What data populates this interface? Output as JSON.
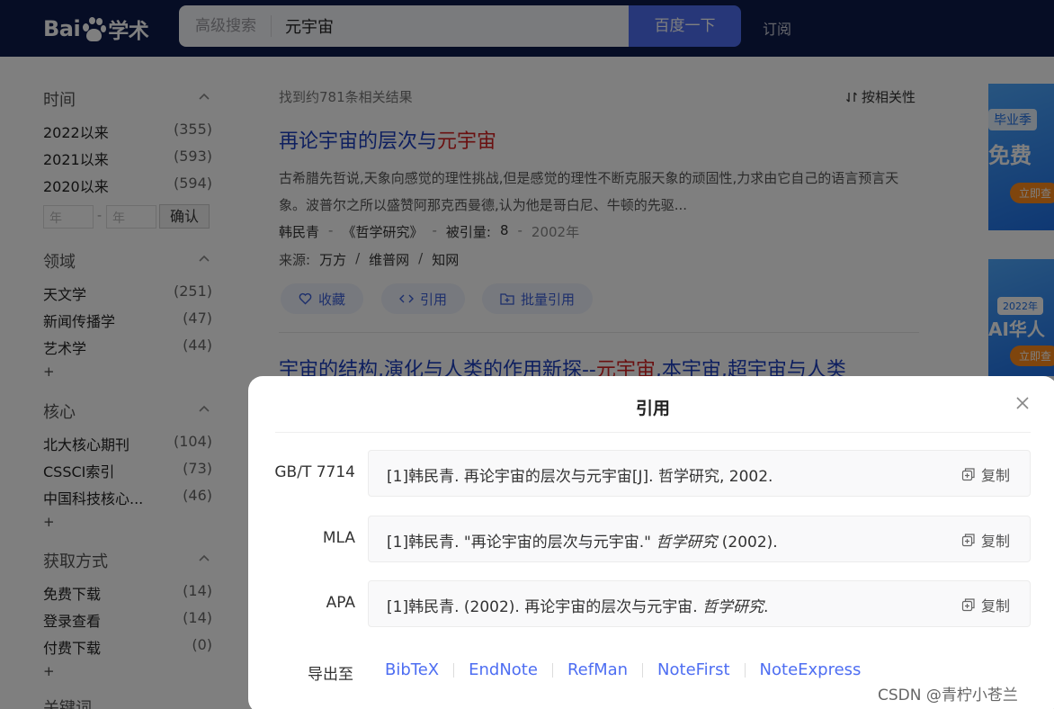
{
  "header": {
    "logo_text_left": "Bai",
    "logo_text_right": "学术",
    "advanced_search": "高级搜索",
    "query": "元宇宙",
    "search_button": "百度一下",
    "subscribe": "订阅"
  },
  "sidebar": {
    "time": {
      "title": "时间",
      "items": [
        {
          "label": "2022以来",
          "count": "(355)"
        },
        {
          "label": "2021以来",
          "count": "(593)"
        },
        {
          "label": "2020以来",
          "count": "(594)"
        }
      ],
      "year_placeholder": "年",
      "dash": "-",
      "confirm": "确认"
    },
    "field": {
      "title": "领域",
      "items": [
        {
          "label": "天文学",
          "count": "(251)"
        },
        {
          "label": "新闻传播学",
          "count": "(47)"
        },
        {
          "label": "艺术学",
          "count": "(44)"
        }
      ],
      "more": "+"
    },
    "core": {
      "title": "核心",
      "items": [
        {
          "label": "北大核心期刊",
          "count": "(104)"
        },
        {
          "label": "CSSCI索引",
          "count": "(73)"
        },
        {
          "label": "中国科技核心...",
          "count": "(46)"
        }
      ],
      "more": "+"
    },
    "access": {
      "title": "获取方式",
      "items": [
        {
          "label": "免费下载",
          "count": "(14)"
        },
        {
          "label": "登录查看",
          "count": "(14)"
        },
        {
          "label": "付费下载",
          "count": "(0)"
        }
      ],
      "more": "+"
    },
    "keywords": {
      "title": "关键词"
    }
  },
  "results": {
    "found": "找到约781条相关结果",
    "sort": "按相关性",
    "items": [
      {
        "title_plain": "再论宇宙的层次与",
        "title_hl": "元宇宙",
        "abstract": "古希腊先哲说,天象向感觉的理性挑战,但是感觉的理性不断克服天象的顽固性,力求由它自己的语言预言天象。波普尔之所以盛赞阿那克西曼德,认为他是哥白尼、牛顿的先驱...",
        "author": "韩民青",
        "journal": "《哲学研究》",
        "cited_label": "被引量:",
        "cited": "8",
        "year": "2002年",
        "source_label": "来源:",
        "sources": [
          "万方",
          "维普网",
          "知网"
        ],
        "actions": {
          "collect": "收藏",
          "cite": "引用",
          "batch_cite": "批量引用"
        }
      },
      {
        "title_part1": "宇宙的结构,演化与人类的作用新探--",
        "title_hl": "元宇宙",
        "title_part2": ",本宇宙,超宇宙与人类"
      }
    ]
  },
  "ads": [
    {
      "line1": "毕业季",
      "line2": "免费",
      "button": "立即查"
    },
    {
      "tag": "2022年",
      "line1": "AI华人",
      "button": "立即查"
    }
  ],
  "cite_dialog": {
    "title": "引用",
    "copy_label": "复制",
    "formats": [
      {
        "label": "GB/T 7714",
        "text": "[1]韩民青. 再论宇宙的层次与元宇宙[J]. 哲学研究, 2002.",
        "text_italic": "",
        "text_after": ""
      },
      {
        "label": "MLA",
        "text": "[1]韩民青. \"再论宇宙的层次与元宇宙.\" ",
        "text_italic": "哲学研究",
        "text_after": " (2002)."
      },
      {
        "label": "APA",
        "text": "[1]韩民青. (2002). 再论宇宙的层次与元宇宙. ",
        "text_italic": "哲学研究",
        "text_after": "."
      }
    ],
    "export_label": "导出至",
    "export_links": [
      "BibTeX",
      "EndNote",
      "RefMan",
      "NoteFirst",
      "NoteExpress"
    ]
  },
  "watermark": "CSDN @青柠小苍兰",
  "colors": {
    "header_bg": "#0d1a4a",
    "accent": "#4e6ef2",
    "title_link": "#1d3fbe",
    "highlight": "#d42020"
  }
}
